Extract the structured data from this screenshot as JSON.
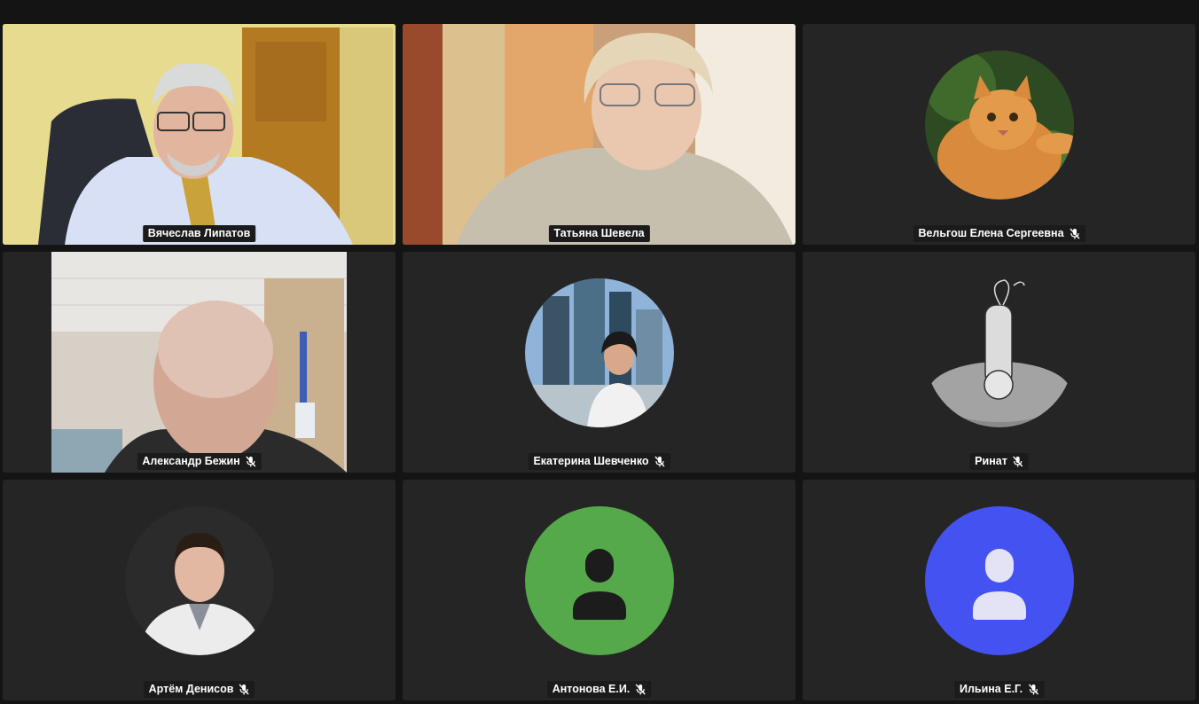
{
  "participants": [
    {
      "name": "Вячеслав Липатов",
      "muted": false,
      "speaking": true,
      "media": "video",
      "icon": "camera-video"
    },
    {
      "name": "Татьяна Шевела",
      "muted": false,
      "speaking": false,
      "media": "video",
      "icon": "camera-video"
    },
    {
      "name": "Вельгош Елена Сергеевна",
      "muted": true,
      "speaking": false,
      "media": "avatar",
      "icon": "cat-photo-avatar"
    },
    {
      "name": "Александр Бежин",
      "muted": true,
      "speaking": false,
      "media": "video",
      "icon": "camera-video"
    },
    {
      "name": "Екатерина Шевченко",
      "muted": true,
      "speaking": false,
      "media": "avatar",
      "icon": "city-photo-avatar"
    },
    {
      "name": "Ринат",
      "muted": true,
      "speaking": false,
      "media": "avatar",
      "icon": "astronaut-drawing-avatar"
    },
    {
      "name": "Артём Денисов",
      "muted": true,
      "speaking": false,
      "media": "avatar",
      "icon": "portrait-photo-avatar"
    },
    {
      "name": "Антонова Е.И.",
      "muted": true,
      "speaking": false,
      "media": "avatar",
      "icon": "person-silhouette-icon"
    },
    {
      "name": "Ильина Е.Г.",
      "muted": true,
      "speaking": false,
      "media": "avatar",
      "icon": "person-silhouette-icon"
    }
  ],
  "colors": {
    "background": "#141414",
    "tile": "#252525",
    "speaking_border": "#3ddc84",
    "green_avatar": "#55a94b",
    "blue_avatar": "#4452f2"
  },
  "mute_icon": "microphone-off-icon"
}
